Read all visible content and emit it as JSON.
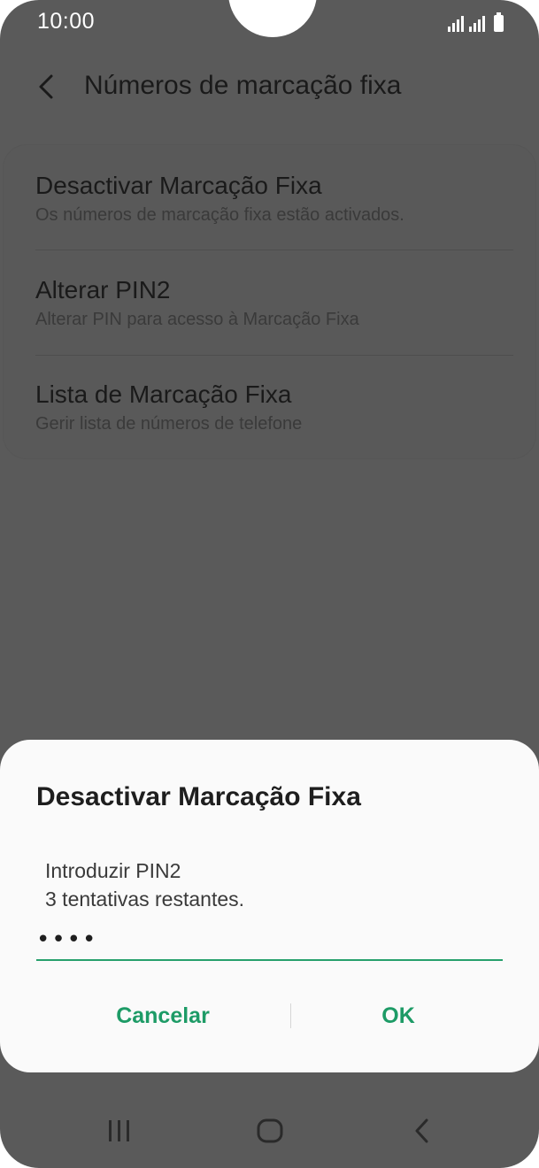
{
  "status_bar": {
    "time": "10:00"
  },
  "header": {
    "title": "Números de marcação fixa",
    "back_icon": "chevron-left-icon"
  },
  "settings": {
    "items": [
      {
        "title": "Desactivar Marcação Fixa",
        "subtitle": "Os números de marcação fixa estão activados."
      },
      {
        "title": "Alterar PIN2",
        "subtitle": "Alterar PIN para acesso à Marcação Fixa"
      },
      {
        "title": "Lista de Marcação Fixa",
        "subtitle": "Gerir lista de números de telefone"
      }
    ]
  },
  "dialog": {
    "title": "Desactivar Marcação Fixa",
    "message_line1": "Introduzir PIN2",
    "message_line2": "3 tentativas restantes.",
    "pin_value": "••••",
    "cancel_label": "Cancelar",
    "ok_label": "OK"
  },
  "colors": {
    "accent": "#1d9b66",
    "scrim": "#5a5a5a",
    "dialog_bg": "#fafafa"
  },
  "nav": {
    "recents_icon": "recents-icon",
    "home_icon": "home-icon",
    "back_icon": "back-icon"
  }
}
